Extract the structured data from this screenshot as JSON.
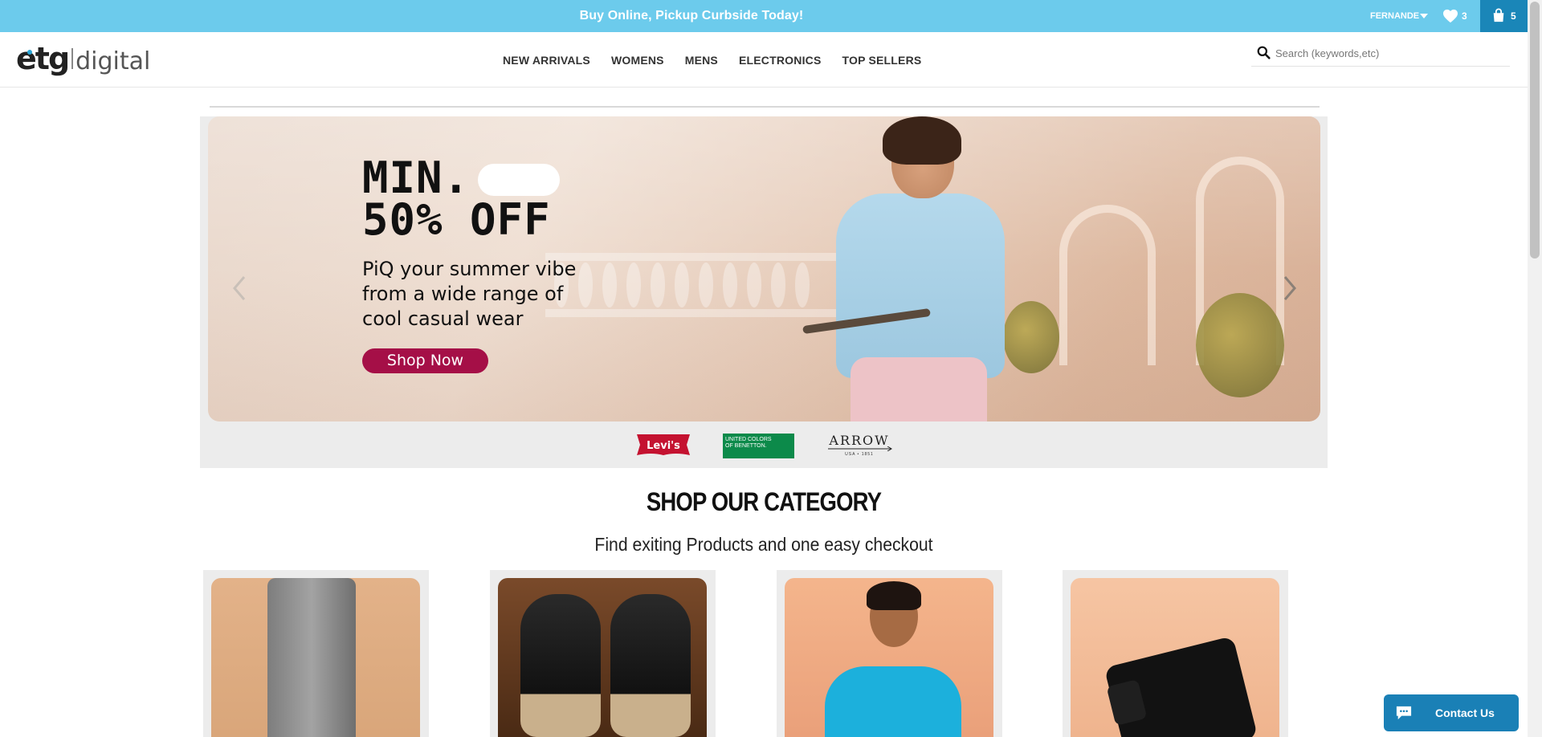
{
  "promo": {
    "text": "Buy Online, Pickup Curbside Today!"
  },
  "account": {
    "name": "FERNANDE",
    "wishlist_count": "3",
    "cart_count": "5"
  },
  "logo": {
    "brand": "etg",
    "suffix": "digital"
  },
  "nav": {
    "items": [
      "NEW ARRIVALS",
      "WOMENS",
      "MENS",
      "ELECTRONICS",
      "TOP SELLERS"
    ]
  },
  "search": {
    "placeholder": "Search (keywords,etc)",
    "value": ""
  },
  "banner": {
    "heading_line1": "MIN.",
    "heading_line2": "50% OFF",
    "subtext": "PiQ your summer vibe from a wide range of cool casual wear",
    "cta": "Shop Now"
  },
  "brands": {
    "levis": "Levi's",
    "ucb_line1": "UNITED COLORS",
    "ucb_line2": "OF BENETTON.",
    "arrow": "ARROW",
    "arrow_sub": "USA • 1851"
  },
  "category": {
    "title": "SHOP OUR CATEGORY",
    "subtitle": "Find exiting Products and one easy checkout"
  },
  "contact": {
    "label": "Contact Us"
  },
  "colors": {
    "promo_bar": "#6ccbec",
    "cart_box": "#1a86b8",
    "cta": "#a50f47",
    "contact": "#1a80b6"
  },
  "icons": {
    "wishlist": "heart-icon",
    "cart": "shopping-bag-icon",
    "search": "search-icon",
    "contact": "chat-icon",
    "prev": "chevron-left-icon",
    "next": "chevron-right-icon"
  }
}
